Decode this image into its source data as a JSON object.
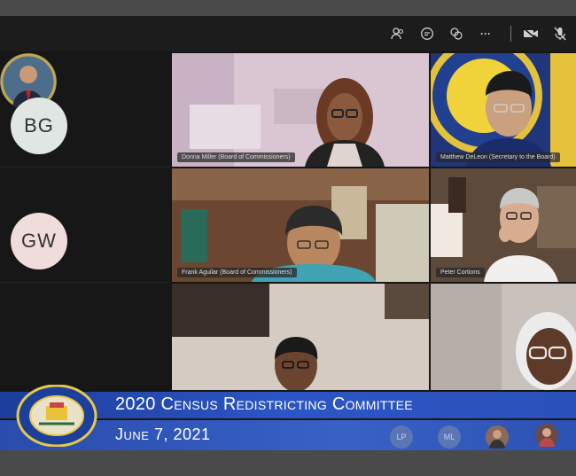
{
  "toolbar": {
    "icons": [
      "people-icon",
      "chat-icon",
      "reactions-icon",
      "more-icon",
      "camera-off-icon",
      "mic-off-icon"
    ],
    "more_label": "···"
  },
  "sidebar": {
    "participants": [
      {
        "initials": "BG",
        "color": "#dfe6e4"
      },
      {
        "initials": "GW",
        "color": "#f1dcdc"
      }
    ]
  },
  "tiles": [
    {
      "name": "Donna Miller (Board of Commissioners)"
    },
    {
      "name": "Matthew DeLeon (Secretary to the Board)"
    },
    {
      "name": "Frank Aguilar (Board of Commissioners)"
    },
    {
      "name": "Peter Cortions"
    }
  ],
  "banner": {
    "title": "2020 Census Redistricting Committee",
    "date": "June 7, 2021",
    "mini_participants": [
      "LP",
      "ML"
    ]
  },
  "colors": {
    "banner_blue": "#2c56c6",
    "toolbar_bg": "#1c1c1c"
  }
}
